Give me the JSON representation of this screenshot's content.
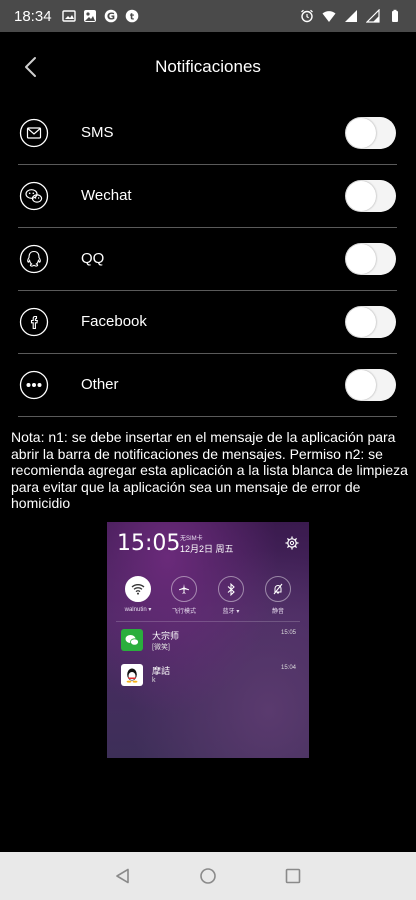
{
  "status_bar": {
    "time": "18:34",
    "left_icons": [
      "image-icon",
      "photos-icon",
      "google-icon",
      "tumblr-icon"
    ],
    "right_icons": [
      "alarm-icon",
      "wifi-icon",
      "signal-icon",
      "signal-icon",
      "battery-icon"
    ]
  },
  "header": {
    "title": "Notificaciones",
    "back_icon": "chevron-left-icon"
  },
  "apps": [
    {
      "id": "sms",
      "label": "SMS",
      "icon": "mail-icon",
      "enabled": false
    },
    {
      "id": "wechat",
      "label": "Wechat",
      "icon": "wechat-icon",
      "enabled": false
    },
    {
      "id": "qq",
      "label": "QQ",
      "icon": "qq-icon",
      "enabled": false
    },
    {
      "id": "facebook",
      "label": "Facebook",
      "icon": "facebook-icon",
      "enabled": false
    },
    {
      "id": "other",
      "label": "Other",
      "icon": "more-dots-icon",
      "enabled": false
    }
  ],
  "note": "Nota: n1: se debe insertar en el mensaje de la aplicación para abrir la barra de notificaciones de mensajes. Permiso n2: se recomienda agregar esta aplicación a la lista blanca de limpieza para evitar que la aplicación sea un mensaje de error de homicidio",
  "example_screenshot": {
    "time": "15:05",
    "sim": "无SIM卡",
    "date": "12月2日 周五",
    "quick_settings": [
      {
        "label": "walnutin ▾",
        "icon": "wifi-icon",
        "on": true
      },
      {
        "label": "飞行模式",
        "icon": "airplane-icon",
        "on": false
      },
      {
        "label": "蓝牙 ▾",
        "icon": "bluetooth-icon",
        "on": false
      },
      {
        "label": "静音",
        "icon": "mute-icon",
        "on": false
      }
    ],
    "notifications": [
      {
        "title": "大宗师",
        "subtitle": "[微笑]",
        "time": "15:05",
        "icon": "wechat-icon"
      },
      {
        "title": "摩詰",
        "subtitle": "k",
        "time": "15:04",
        "icon": "qq-icon"
      }
    ]
  },
  "nav_bar": {
    "back": "nav-back-icon",
    "home": "nav-home-icon",
    "recents": "nav-recents-icon"
  },
  "colors": {
    "background": "#000000",
    "status_bar": "#4a4a4a",
    "divider": "#5a5a5a",
    "toggle_off": "#f4f4f4",
    "nav_bar": "#e9e9e9"
  }
}
